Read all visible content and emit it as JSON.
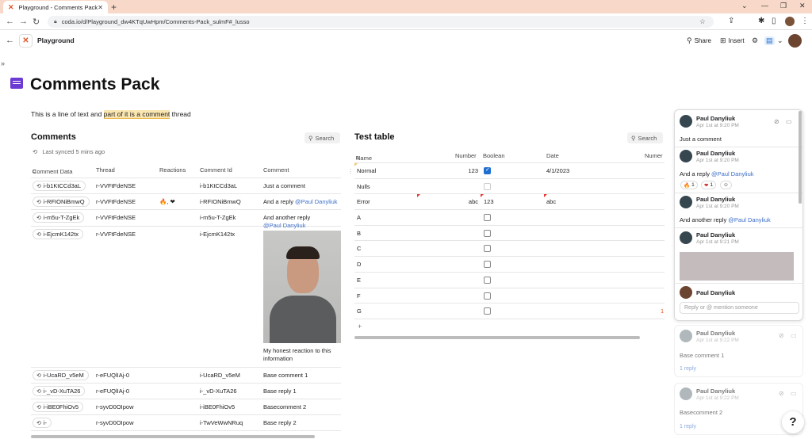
{
  "browser": {
    "tab_title": "Playground - Comments Pack",
    "url": "coda.io/d/Playground_dw4KTqUwHpm/Comments-Pack_sulmF#_lusso"
  },
  "coda": {
    "doc_name": "Playground",
    "share_label": "Share",
    "insert_label": "Insert"
  },
  "page": {
    "title": "Comments Pack",
    "intro_before": "This is a line of text and ",
    "intro_highlight": "part of it is a comment",
    "intro_after": " thread"
  },
  "comments_section": {
    "title": "Comments",
    "search_label": "Search",
    "synced_text": "Last synced 5 mins ago",
    "columns": [
      "Comment Data",
      "Thread",
      "Reactions",
      "Comment Id",
      "Comment"
    ],
    "rows": [
      {
        "data": "i-b1KtCCd3aL",
        "thread": "r-VVFtFdeNSE",
        "reactions": "",
        "id": "i-b1KtCCd3aL",
        "comment": "Just a comment",
        "mention": ""
      },
      {
        "data": "i-RFIONiBmwQ",
        "thread": "r-VVFtFdeNSE",
        "reactions": "🔥, ❤",
        "id": "i-RFIONiBmwQ",
        "comment": "And a reply ",
        "mention": "@Paul Danyliuk"
      },
      {
        "data": "i-m5u-T-ZgEk",
        "thread": "r-VVFtFdeNSE",
        "reactions": "",
        "id": "i-m5u-T-ZgEk",
        "comment": "And another reply",
        "mention": "@Paul Danyliuk"
      },
      {
        "data": "i-EjcmK142tx",
        "thread": "r-VVFtFdeNSE",
        "reactions": "",
        "id": "i-EjcmK142tx",
        "comment": "My honest reaction to this information",
        "mention": ""
      },
      {
        "data": "i-UcaRD_v5eM",
        "thread": "r-eFUQlIAj-0",
        "reactions": "",
        "id": "i-UcaRD_v5eM",
        "comment": "Base comment 1",
        "mention": ""
      },
      {
        "data": "i-_vD-XuTA26",
        "thread": "r-eFUQlIAj-0",
        "reactions": "",
        "id": "i-_vD-XuTA26",
        "comment": "Base reply 1",
        "mention": ""
      },
      {
        "data": "i-iBE0FhiOv5",
        "thread": "r-syvD0OIpow",
        "reactions": "",
        "id": "i-iBE0FhiOv5",
        "comment": "Basecomment 2",
        "mention": ""
      },
      {
        "data": "i-",
        "thread": "r-syvD0OIpow",
        "reactions": "",
        "id": "i-TwVeWwNRuq",
        "comment": "Base reply 2",
        "mention": ""
      }
    ]
  },
  "test_table": {
    "title": "Test table",
    "search_label": "Search",
    "columns": [
      "Name",
      "Number",
      "Boolean",
      "Date",
      "Numer"
    ],
    "rows": [
      {
        "name": "Normal",
        "number": "123",
        "bool": "checked",
        "date": "4/1/2023"
      },
      {
        "name": "Nulls",
        "number": "",
        "bool": "disabled",
        "date": ""
      },
      {
        "name": "Error",
        "number": "abc",
        "bool": "123",
        "date": "abc"
      },
      {
        "name": "A",
        "number": "",
        "bool": "unchecked",
        "date": ""
      },
      {
        "name": "B",
        "number": "",
        "bool": "unchecked",
        "date": ""
      },
      {
        "name": "C",
        "number": "",
        "bool": "unchecked",
        "date": ""
      },
      {
        "name": "D",
        "number": "",
        "bool": "unchecked",
        "date": ""
      },
      {
        "name": "E",
        "number": "",
        "bool": "unchecked",
        "date": ""
      },
      {
        "name": "F",
        "number": "",
        "bool": "unchecked",
        "date": ""
      },
      {
        "name": "G",
        "number": "",
        "bool": "unchecked",
        "date": ""
      }
    ],
    "partial_value": "1",
    "add_row": "+"
  },
  "comment_panel": {
    "thread1": [
      {
        "author": "Paul Danyliuk",
        "date": "Apr 1st at 9:20 PM",
        "body": "Just a comment",
        "mention": ""
      },
      {
        "author": "Paul Danyliuk",
        "date": "Apr 1st at 9:20 PM",
        "body": "And a reply ",
        "mention": "@Paul Danyliuk"
      },
      {
        "author": "Paul Danyliuk",
        "date": "Apr 1st at 9:20 PM",
        "body": "And another reply ",
        "mention": "@Paul Danyliuk"
      },
      {
        "author": "Paul Danyliuk",
        "date": "Apr 1st at 9:21 PM",
        "body": "",
        "mention": ""
      }
    ],
    "reactions": [
      {
        "emoji": "🔥",
        "count": "1"
      },
      {
        "emoji": "❤",
        "count": "1"
      }
    ],
    "reply_author": "Paul Danyliuk",
    "reply_placeholder": "Reply or @ mention someone",
    "thread2": {
      "author": "Paul Danyliuk",
      "date": "Apr 1st at 9:22 PM",
      "body": "Base comment 1",
      "reply_link": "1 reply"
    },
    "thread3": {
      "author": "Paul Danyliuk",
      "date": "Apr 1st at 9:22 PM",
      "body": "Basecomment 2",
      "reply_link": "1 reply"
    }
  },
  "help_label": "?",
  "icons": [
    "back-icon",
    "forward-icon",
    "reload-icon",
    "lock-icon",
    "share-icon",
    "insert-icon",
    "gear-icon",
    "comment-mode-icon",
    "search-icon",
    "sync-icon",
    "bookmark-icon",
    "checkmark-circle-icon",
    "sidebar-icon",
    "sidebar-expand-icon"
  ],
  "colors": {
    "accent": "#6c3bd4",
    "highlight": "#fbe6b0",
    "link": "#3d6fc8",
    "checkbox": "#1f6fd1",
    "error": "#e53935",
    "tabstrip": "#f8d8c8"
  }
}
